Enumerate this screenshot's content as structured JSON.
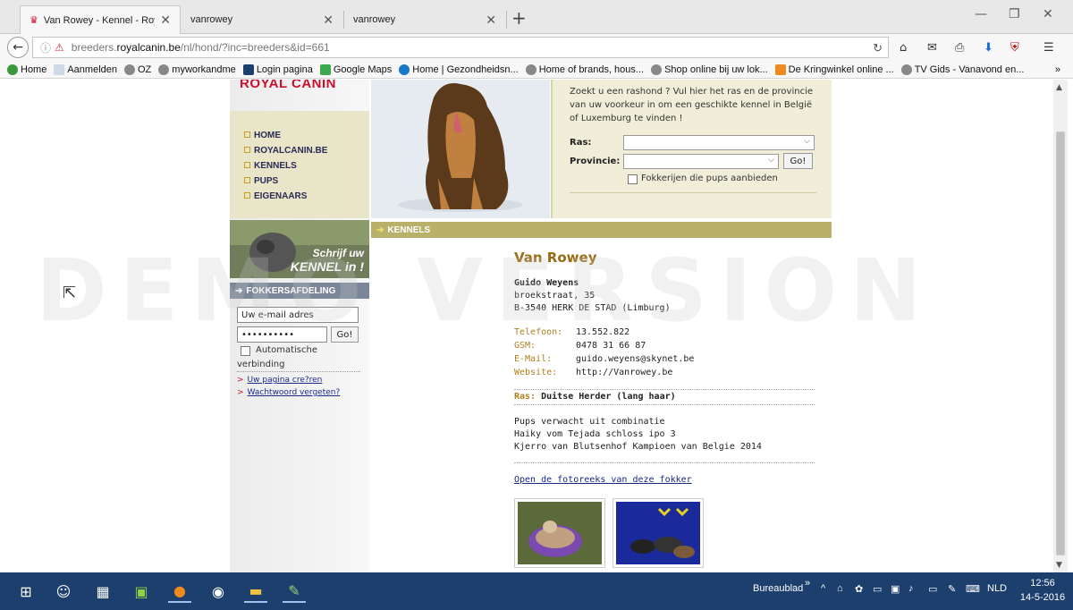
{
  "browser": {
    "tabs": [
      {
        "title": "Van Rowey - Kennel - Roy...",
        "active": true
      },
      {
        "title": "vanrowey",
        "active": false
      },
      {
        "title": "vanrowey",
        "active": false
      }
    ],
    "url_prefix": "breeders.",
    "url_domain": "royalcanin.be",
    "url_path": "/nl/hond/?inc=breeders&id=661",
    "bookmarks": [
      "Home",
      "Aanmelden",
      "OZ",
      "myworkandme",
      "Login pagina",
      "Google Maps",
      "Home | Gezondheidsn...",
      "Home of brands, hous...",
      "Shop online bij uw lok...",
      "De Kringwinkel online ...",
      "TV Gids - Vanavond en..."
    ],
    "bookmarks_overflow": "»"
  },
  "site": {
    "brand": "ROYAL CANIN",
    "menu": [
      "HOME",
      "ROYALCANIN.BE",
      "KENNELS",
      "PUPS",
      "EIGENAARS"
    ],
    "banner_line1": "Schrijf uw",
    "banner_line2": "KENNEL in !",
    "kennels_bar": "KENNELS",
    "fokker_bar": "FOKKERSAFDELING",
    "email_value": "Uw e-mail adres",
    "password_value": "••••••••••",
    "go_label": "Go!",
    "auto_label_1": "Automatische",
    "auto_label_2": "verbinding",
    "link_create": "Uw pagina cre?ren",
    "link_forgot": "Wachtwoord vergeten?"
  },
  "search": {
    "intro": "Zoekt u een rashond ? Vul hier het ras en de provincie van uw voorkeur in om een geschikte kennel in België of Luxemburg te vinden !",
    "ras_label": "Ras:",
    "provincie_label": "Provincie:",
    "go_label": "Go!",
    "pups_label": "Fokkerijen die pups aanbieden"
  },
  "kennel": {
    "name": "Van Rowey",
    "owner": "Guido Weyens",
    "street": "broekstraat, 35",
    "city": "B-3540 HERK DE STAD (Limburg)",
    "contacts": [
      {
        "label": "Telefoon:",
        "value": "13.552.822"
      },
      {
        "label": "GSM:",
        "value": "0478 31 66 87"
      },
      {
        "label": "E-Mail:",
        "value": "guido.weyens@skynet.be"
      },
      {
        "label": "Website:",
        "value": "http://Vanrowey.be"
      }
    ],
    "ras_label": "Ras:",
    "ras_value": "Duitse Herder (lang haar)",
    "desc": [
      "Pups verwacht uit combinatie",
      "Haiky vom Tejada schloss ipo 3",
      "Kjerro van Blutsenhof Kampioen van Belgie 2014"
    ],
    "photo_link": "Open de fotoreeks van deze fokker"
  },
  "watermark": "DEMO VERSION",
  "taskbar": {
    "desktop_label": "Bureaublad",
    "lang": "NLD",
    "time": "12:56",
    "date": "14-5-2016"
  }
}
